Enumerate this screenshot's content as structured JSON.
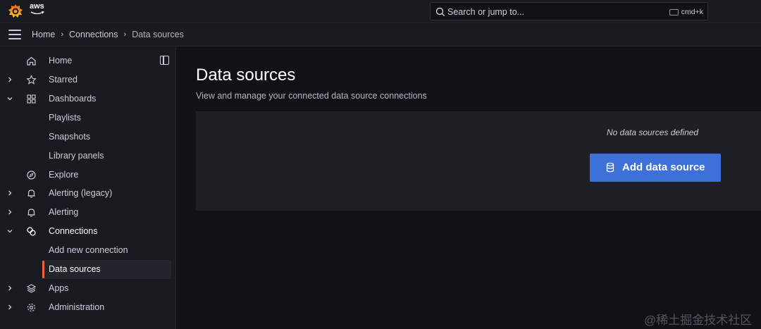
{
  "topbar": {
    "brand": "aws",
    "search_placeholder": "Search or jump to...",
    "shortcut": "cmd+k"
  },
  "breadcrumbs": [
    "Home",
    "Connections",
    "Data sources"
  ],
  "sidebar": {
    "items": [
      {
        "label": "Home",
        "icon": "home-icon",
        "expandable": false,
        "expanded": false,
        "indent": 0
      },
      {
        "label": "Starred",
        "icon": "star-icon",
        "expandable": true,
        "expanded": false,
        "indent": 0
      },
      {
        "label": "Dashboards",
        "icon": "apps-icon",
        "expandable": true,
        "expanded": true,
        "indent": 0
      },
      {
        "label": "Playlists",
        "icon": "",
        "expandable": false,
        "expanded": false,
        "indent": 1
      },
      {
        "label": "Snapshots",
        "icon": "",
        "expandable": false,
        "expanded": false,
        "indent": 1
      },
      {
        "label": "Library panels",
        "icon": "",
        "expandable": false,
        "expanded": false,
        "indent": 1
      },
      {
        "label": "Explore",
        "icon": "compass-icon",
        "expandable": false,
        "expanded": false,
        "indent": 0
      },
      {
        "label": "Alerting (legacy)",
        "icon": "bell-icon",
        "expandable": true,
        "expanded": false,
        "indent": 0
      },
      {
        "label": "Alerting",
        "icon": "bell-icon",
        "expandable": true,
        "expanded": false,
        "indent": 0
      },
      {
        "label": "Connections",
        "icon": "connections-icon",
        "expandable": true,
        "expanded": true,
        "indent": 0
      },
      {
        "label": "Add new connection",
        "icon": "",
        "expandable": false,
        "expanded": false,
        "indent": 1
      },
      {
        "label": "Data sources",
        "icon": "",
        "expandable": false,
        "expanded": false,
        "indent": 1,
        "active": true
      },
      {
        "label": "Apps",
        "icon": "layers-icon",
        "expandable": true,
        "expanded": false,
        "indent": 0
      },
      {
        "label": "Administration",
        "icon": "cog-icon",
        "expandable": true,
        "expanded": false,
        "indent": 0
      }
    ]
  },
  "main": {
    "title": "Data sources",
    "subtitle": "View and manage your connected data source connections",
    "empty_text": "No data sources defined",
    "add_button": "Add data source"
  },
  "watermark": "@稀土掘金技术社区",
  "colors": {
    "accent": "#3d71d9",
    "active_bar": "#f55f3e",
    "background": "#111217",
    "panel": "#181b1f"
  }
}
